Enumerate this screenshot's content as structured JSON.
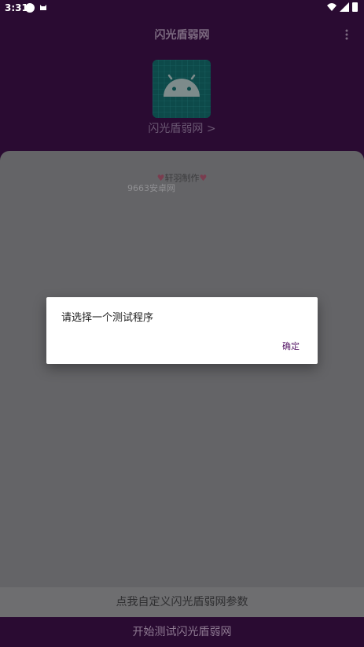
{
  "status_bar": {
    "time": "3:31"
  },
  "app_bar": {
    "title": "闪光盾弱网",
    "more_icon": "more-vert-icon"
  },
  "app_header": {
    "logo_icon": "android-icon",
    "app_link": "闪光盾弱网 >"
  },
  "card": {
    "credit_text": "轩羽制作",
    "credit_heart_icon": "heart-icon",
    "watermark": "9663安卓网"
  },
  "dialog": {
    "message": "请选择一个测试程序",
    "confirm_label": "确定"
  },
  "buttons": {
    "custom_params_label": "点我自定义闪光盾弱网参数",
    "start_test_label": "开始测试闪光盾弱网"
  },
  "colors": {
    "background": "#2a0b32",
    "card": "#646467",
    "accent": "#5a1d6a",
    "dialog_bg": "#ffffff"
  }
}
